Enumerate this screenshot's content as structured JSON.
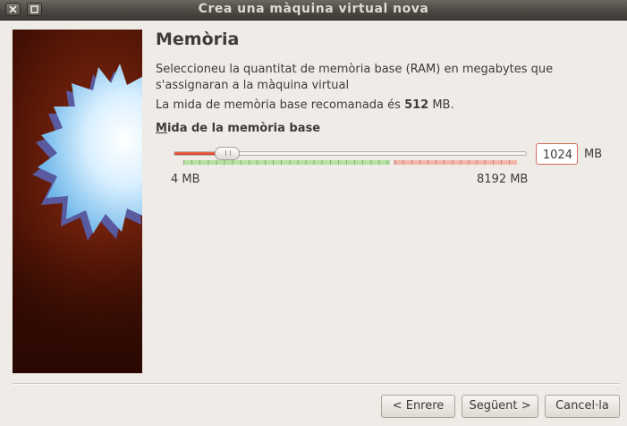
{
  "window": {
    "title": "Crea una màquina virtual nova",
    "close_icon": "close-icon",
    "maximize_icon": "maximize-icon"
  },
  "page": {
    "heading": "Memòria",
    "description": "Seleccioneu la quantitat de memòria base (RAM) en megabytes que s'assignaran a la màquina virtual",
    "recommend_prefix": "La mida de memòria base recomanada és ",
    "recommend_value": "512",
    "recommend_suffix": " MB."
  },
  "memory": {
    "label_mnemonic": "M",
    "label_rest": "ida de la memòria base",
    "value": "1024",
    "unit": "MB",
    "min_label": "4 MB",
    "max_label": "8192 MB",
    "slider": {
      "min": 4,
      "max": 8192,
      "value": 1024
    },
    "scale_fraction": {
      "green": 0.62,
      "yellow": 0.63,
      "red": 1.0
    },
    "colors": {
      "fill": "#e0492a",
      "green": "#b5e3a3",
      "red": "#f5b5a8",
      "input_border": "#d46c5a"
    }
  },
  "buttons": {
    "back": "< Enrere",
    "next": "Següent >",
    "cancel": "Cancel·la"
  }
}
